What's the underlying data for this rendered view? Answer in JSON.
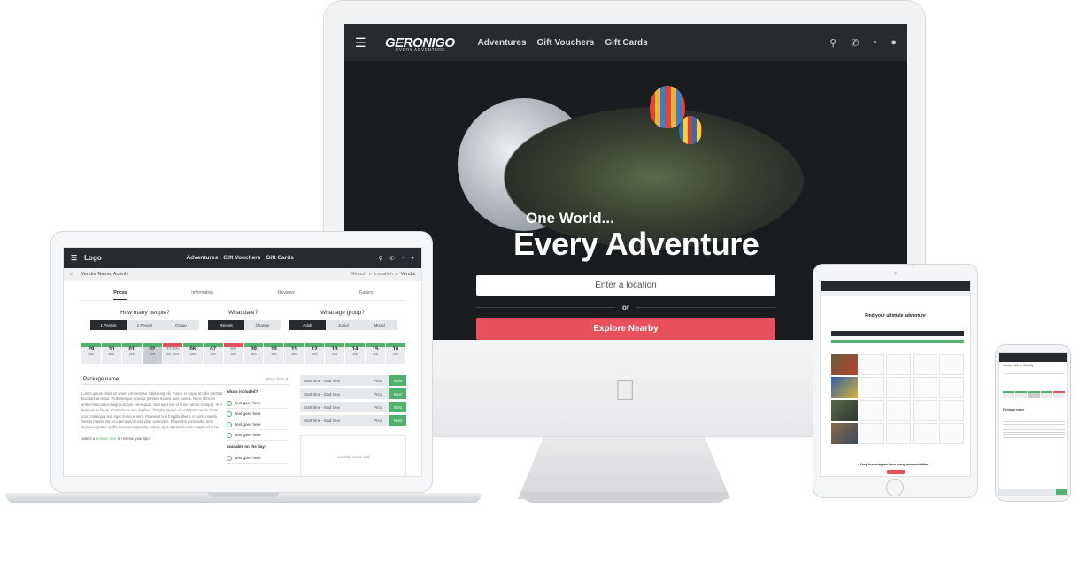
{
  "desktop": {
    "brand": "GERONIGO",
    "brand_tagline": "EVERY ADVENTURE",
    "nav_links": [
      "Adventures",
      "Gift Vouchers",
      "Gift Cards"
    ],
    "hero_subtitle": "One World...",
    "hero_title": "Every Adventure",
    "location_placeholder": "Enter a location",
    "or_text": "or",
    "explore_button": "Explore Nearby"
  },
  "laptop": {
    "logo": "Logo",
    "nav_links": [
      "Adventures",
      "Gift Vouchers",
      "Gift Cards"
    ],
    "breadcrumb_title": "Vendor Name, Activity",
    "breadcrumb_path": [
      "Search",
      "Location",
      "Vendor"
    ],
    "tabs": [
      "Prices",
      "Information",
      "Reviews",
      "Gallery"
    ],
    "q_people": "How many people?",
    "q_people_opts": [
      "1 Person",
      "2 People",
      "Group"
    ],
    "q_date": "What date?",
    "q_date_opts": [
      "Recent",
      "Change"
    ],
    "q_age": "What age group?",
    "q_age_opts": [
      "Adult",
      "Junior",
      "Mixed"
    ],
    "dates": [
      {
        "num": "29",
        "mon": "MAR"
      },
      {
        "num": "30",
        "mon": "MAR"
      },
      {
        "num": "01",
        "mon": "APR"
      },
      {
        "num": "02",
        "mon": "APR"
      },
      {
        "num": "03 05",
        "mon": "APR - APR"
      },
      {
        "num": "06",
        "mon": "APR"
      },
      {
        "num": "07",
        "mon": "APR"
      },
      {
        "num": "08",
        "mon": "APR"
      },
      {
        "num": "09",
        "mon": "APR"
      },
      {
        "num": "10",
        "mon": "APR"
      },
      {
        "num": "11",
        "mon": "APR"
      },
      {
        "num": "12",
        "mon": "APR"
      },
      {
        "num": "13",
        "mon": "APR"
      },
      {
        "num": "14",
        "mon": "APR"
      },
      {
        "num": "15",
        "mon": "APR"
      },
      {
        "num": "16",
        "mon": "APR"
      }
    ],
    "package_name": "Package name",
    "price_from": "Price from",
    "lorem": "Lorem ipsum dolor sit amet, consectetur adipiscing elit. Fusce et turpis at odio porttitor tincidunt at tellus. Pellentesque gravida pretium mauris quis cursus. Nunc ultricies ante consectetur magna dictum consequat. Sed eget nisl id nunc rutrum volutpat. In in fermentum lacus. Curabitur in nisl dapibus, fringilla sapien ut, volutpat mauris. Cras non consequat leo, eget rhoncus sem. Praesent non fringilla libero, in porta mauris. Sed et massa vel arcu tempus lacinia vitae vel metus. Phasellus commodo, ante laoreet egestas mollis, eros sem gravida massa, quis dignissim ante magna id arcu.",
    "select_prefix": "Select a",
    "select_link": "session time",
    "select_suffix": "to reserve your spot",
    "whats_included": "whats included?",
    "included_items": [
      "text goes here",
      "text goes here",
      "text goes here",
      "text goes here"
    ],
    "available_on_day": "available on the day:",
    "day_items": [
      "text goes here"
    ],
    "slot_time": "Start time - End time",
    "slot_price": "Price",
    "slot_next": "Next",
    "voucher_text": "voucher cross sell"
  },
  "tablet": {
    "title": "Find your ultimate adventure",
    "footer": "Keep browsing we have many more activities..."
  },
  "phone": {
    "breadcrumb_title": "Vendor Name, Activity",
    "package_name": "Package name"
  }
}
